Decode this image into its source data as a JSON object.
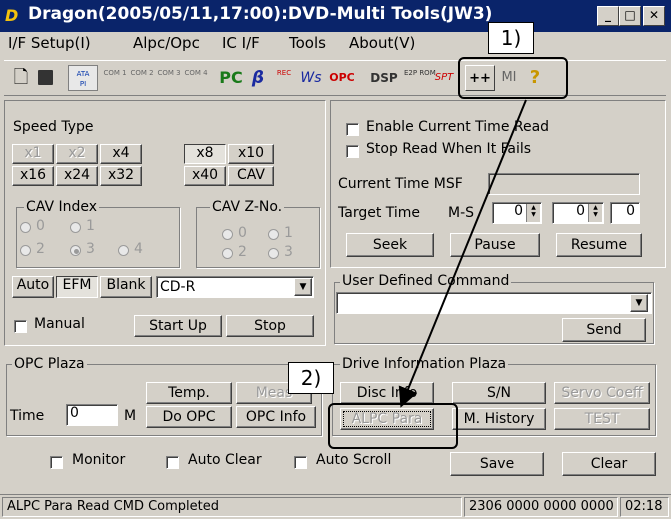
{
  "window": {
    "title": "Dragon(2005/05/11,17:00):DVD-Multi Tools(JW3)",
    "min": "_",
    "max": "□",
    "close": "✕"
  },
  "menu": [
    "I/F Setup(I)",
    "Alpc/Opc",
    "IC I/F",
    "Tools",
    "About(V)"
  ],
  "toolbar": {
    "ata": "ATA",
    "ata_sub": "PI",
    "com1": "COM 1",
    "com2": "COM 2",
    "com3": "COM 3",
    "com4": "COM 4",
    "pc": "PC",
    "beta": "β",
    "rec": "REC",
    "ws": "Ws",
    "opc": "OPC",
    "dsp": "DSP",
    "e2p": "E2P ROM",
    "spt": "SPT",
    "plusplus": "++",
    "mi": "MI",
    "help": "?"
  },
  "speed": {
    "label": "Speed Type",
    "buttons": [
      "x1",
      "x2",
      "x4",
      "x8",
      "x10",
      "x16",
      "x24",
      "x32",
      "x40",
      "CAV"
    ],
    "selected": "x8"
  },
  "cav_index": {
    "label": "CAV Index",
    "options": [
      "0",
      "1",
      "2",
      "3",
      "4"
    ],
    "selected": "3"
  },
  "cav_zno": {
    "label": "CAV Z-No.",
    "options": [
      "0",
      "1",
      "2",
      "3"
    ]
  },
  "mode": {
    "auto": "Auto",
    "efm": "EFM",
    "blank": "Blank",
    "disc_type": "CD-R"
  },
  "manual": {
    "label": "Manual",
    "start": "Start Up",
    "stop": "Stop"
  },
  "time_read": {
    "enable_label": "Enable Current Time Read",
    "stop_label": "Stop Read When It Fails",
    "current_label": "Current Time  MSF",
    "target_label": "Target Time",
    "ms_label": "M-S",
    "m_value": "0",
    "s_value": "0",
    "f_value": "0",
    "seek": "Seek",
    "pause": "Pause",
    "resume": "Resume"
  },
  "user_cmd": {
    "label": "User Defined Command",
    "send": "Send"
  },
  "opc": {
    "label": "OPC Plaza",
    "temp": "Temp.",
    "meas": "Meas",
    "time_label": "Time",
    "time_value": "0",
    "m_label": "M",
    "do_opc": "Do OPC",
    "opc_info": "OPC Info"
  },
  "drive": {
    "label": "Drive Information Plaza",
    "disc_info": "Disc Info",
    "sn": "S/N",
    "servo": "Servo Coeff",
    "alpc": "ALPC Para",
    "history": "M. History",
    "test": "TEST"
  },
  "footer": {
    "monitor": "Monitor",
    "auto_clear": "Auto Clear",
    "auto_scroll": "Auto Scroll",
    "save": "Save",
    "clear": "Clear"
  },
  "status": {
    "message": "ALPC Para Read CMD Completed",
    "codes": "2306 0000 0000 0000",
    "time": "02:18"
  },
  "annotations": {
    "callout1": "1)",
    "callout2": "2)"
  }
}
